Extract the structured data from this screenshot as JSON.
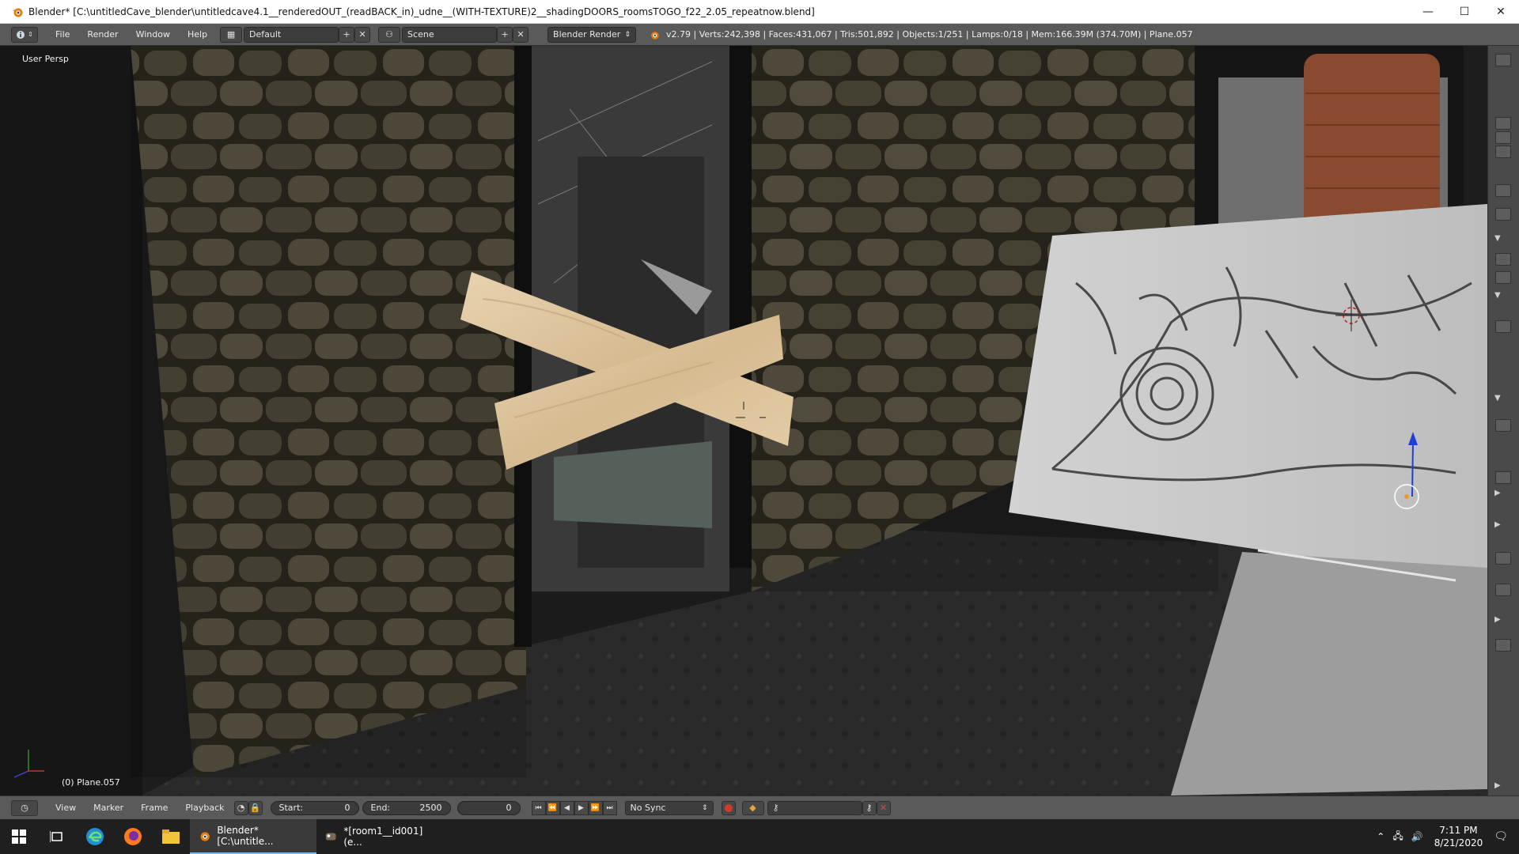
{
  "window": {
    "title": "Blender* [C:\\untitledCave_blender\\untitledcave4.1__renderedOUT_(readBACK_in)_udne__(WITH-TEXTURE)2__shadingDOORS_roomsTOGO_f22_2.05_repeatnow.blend]",
    "minimize": "—",
    "maximize": "☐",
    "close": "✕"
  },
  "infobar": {
    "menus": [
      "File",
      "Render",
      "Window",
      "Help"
    ],
    "layout": "Default",
    "scene": "Scene",
    "engine": "Blender Render",
    "stats": "v2.79 | Verts:242,398 | Faces:431,067 | Tris:501,892 | Objects:1/251 | Lamps:0/18 | Mem:166.39M (374.70M) | Plane.057"
  },
  "viewport": {
    "view_label": "User Persp",
    "object_label": "(0) Plane.057"
  },
  "timeline": {
    "menus": [
      "View",
      "Marker",
      "Frame",
      "Playback"
    ],
    "start_label": "Start:",
    "start_value": "0",
    "end_label": "End:",
    "end_value": "2500",
    "current_frame": "0",
    "sync": "No Sync"
  },
  "taskbar": {
    "tasks": [
      {
        "label": "Blender* [C:\\untitle...",
        "active": true
      },
      {
        "label": "*[room1__id001] (e...",
        "active": false
      }
    ],
    "time": "7:11 PM",
    "date": "8/21/2020"
  },
  "colors": {
    "header_bg": "#5a5a5a",
    "field_bg": "#3d3d3d",
    "taskbar_bg": "#1f1f1f",
    "accent": "#76b9ed"
  }
}
